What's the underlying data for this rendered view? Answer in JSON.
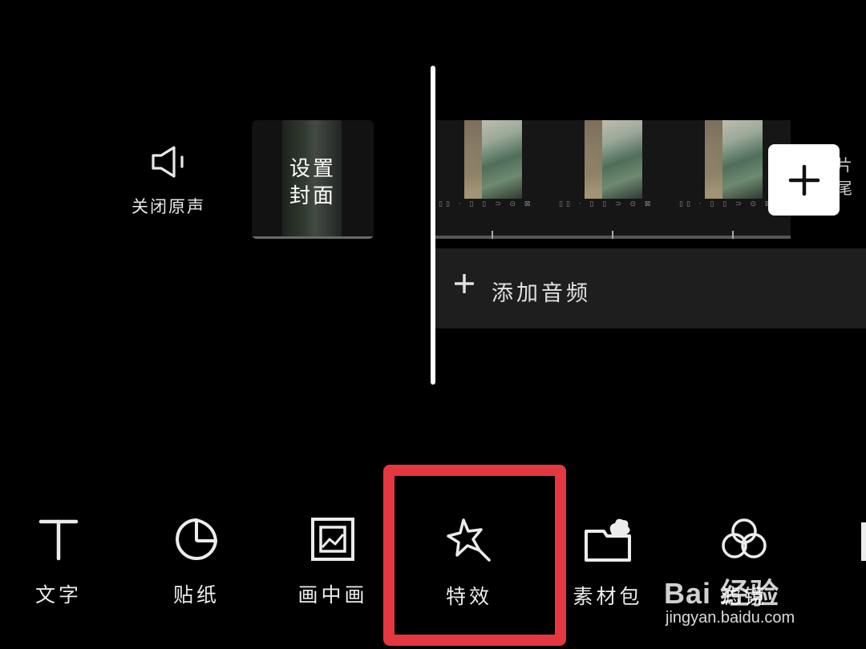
{
  "mute_button": {
    "label": "关闭原声",
    "icon": "speaker-icon"
  },
  "cover_button": {
    "label": "设置\n封面"
  },
  "timeline": {
    "end_hint": "片尾",
    "add_clip_icon": "plus-icon",
    "audio_track": {
      "label": "添加音频",
      "icon": "plus-icon"
    }
  },
  "toolbar": {
    "items": [
      {
        "label": "文字",
        "icon": "text-t-icon"
      },
      {
        "label": "贴纸",
        "icon": "sticker-icon"
      },
      {
        "label": "画中画",
        "icon": "picture-in-picture-icon"
      },
      {
        "label": "特效",
        "icon": "magic-star-icon"
      },
      {
        "label": "素材包",
        "icon": "material-pack-icon"
      },
      {
        "label": "滤镜",
        "icon": "filter-icon"
      }
    ]
  },
  "watermark": {
    "logo": "Bai 经验",
    "url": "jingyan.baidu.com"
  },
  "colors": {
    "background": "#000000",
    "highlight": "#e53740",
    "track": "#1e1e1e"
  }
}
